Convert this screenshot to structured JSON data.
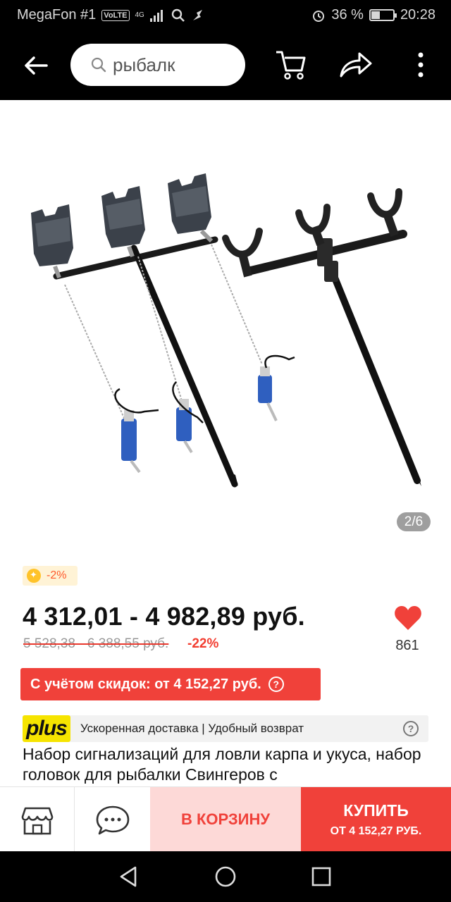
{
  "status_bar": {
    "carrier": "MegaFon #1",
    "volte": "VoLTE",
    "network": "4G",
    "battery": "36 %",
    "time": "20:28"
  },
  "header": {
    "search_query": "рыбалк",
    "icons": [
      "back-arrow-icon",
      "search-icon",
      "cart-icon",
      "share-icon",
      "more-vert-icon"
    ]
  },
  "gallery": {
    "page_indicator": "2/6",
    "current": 2,
    "total": 6
  },
  "pricing": {
    "coin_discount": "-2%",
    "price_range": "4 312,01 - 4 982,89 руб.",
    "old_price_range": "5 528,38 - 6 388,55 руб.",
    "discount_percent": "-22%",
    "with_discounts": "С учётом скидок: от 4 152,27 руб.",
    "help_glyph": "?"
  },
  "favorite": {
    "count": "861",
    "color": "#f0413a"
  },
  "plus": {
    "logo": "plus",
    "text": "Ускоренная доставка | Удобный возврат",
    "help_glyph": "?"
  },
  "product": {
    "title": "Набор сигнализаций для ловли карпа и укуса, набор головок для рыбалки Свингеров с"
  },
  "actions": {
    "add_to_cart": "В КОРЗИНУ",
    "buy": "КУПИТЬ",
    "buy_sub": "ОТ 4 152,27 РУБ.",
    "icons": [
      "store-icon",
      "chat-icon"
    ]
  },
  "colors": {
    "accent": "#f0413a",
    "accent_light": "#fdd9d7",
    "plus_yellow": "#f6e400",
    "coin_bg": "#fff3d6"
  }
}
